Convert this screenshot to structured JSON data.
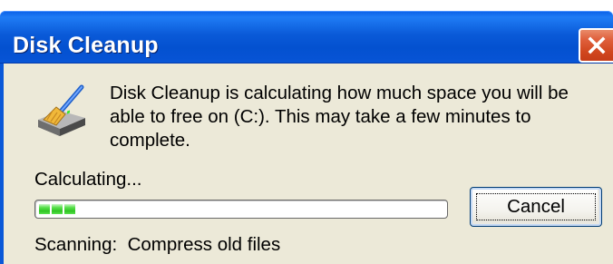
{
  "window": {
    "title": "Disk Cleanup",
    "close_icon": "close-icon",
    "app_icon": "disk-cleanup-icon"
  },
  "message": {
    "text": "Disk Cleanup is calculating how much space you will be able to free on  (C:). This may take a few minutes to complete."
  },
  "status": {
    "label": "Calculating...",
    "progress_fraction": 0.08,
    "progress_blocks": 3
  },
  "buttons": {
    "cancel_label": "Cancel"
  },
  "scanning": {
    "label": "Scanning:",
    "item": "Compress old files"
  },
  "colors": {
    "titlebar": "#0a58d8",
    "dialog_bg": "#ece9d8",
    "close_button": "#d1471f",
    "progress_green": "#2fc423"
  }
}
